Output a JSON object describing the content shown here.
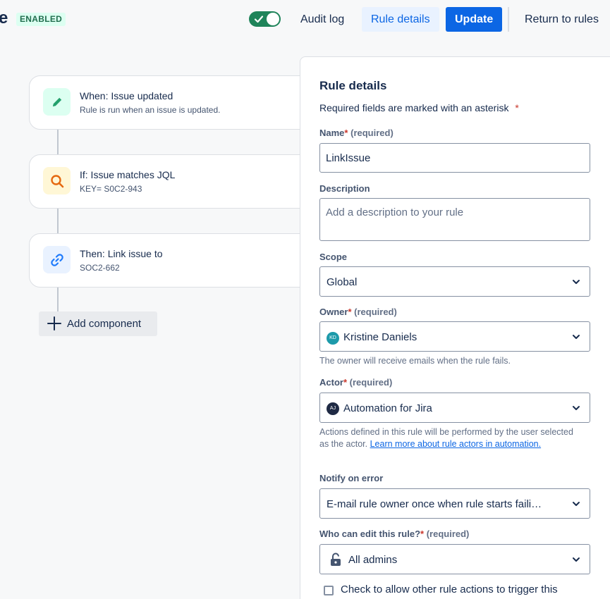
{
  "header": {
    "title_fragment": "e",
    "status_badge": "ENABLED",
    "audit_log_label": "Audit log",
    "rule_details_label": "Rule details",
    "update_label": "Update",
    "return_label": "Return to rules",
    "toggle_enabled": true
  },
  "flow": {
    "steps": [
      {
        "title": "When: Issue updated",
        "subtitle": "Rule is run when an issue is updated.",
        "icon": "pencil-icon",
        "icon_bg": "#dcfff1",
        "icon_color": "#22a06b"
      },
      {
        "title": "If: Issue matches JQL",
        "subtitle": "KEY= S0C2-943",
        "icon": "search-icon",
        "icon_bg": "#fff7d6",
        "icon_color": "#e56910"
      },
      {
        "title": "Then: Link issue to",
        "subtitle": "SOC2-662",
        "icon": "link-icon",
        "icon_bg": "#e9f2ff",
        "icon_color": "#1d7afc"
      }
    ],
    "add_component_label": "Add component"
  },
  "panel": {
    "title": "Rule details",
    "required_note": "Required fields are marked with an asterisk",
    "asterisk": "*",
    "required_suffix": "(required)",
    "name": {
      "label": "Name",
      "value": "LinkIssue"
    },
    "description": {
      "label": "Description",
      "placeholder": "Add a description to your rule"
    },
    "scope": {
      "label": "Scope",
      "value": "Global"
    },
    "owner": {
      "label": "Owner",
      "value": "Kristine Daniels",
      "avatar": "KD",
      "helper": "The owner will receive emails when the rule fails."
    },
    "actor": {
      "label": "Actor",
      "value": "Automation for Jira",
      "avatar": "AJ",
      "helper_text": "Actions defined in this rule will be performed by the user selected as the actor.",
      "helper_link": "Learn more about rule actors in automation."
    },
    "notify": {
      "label": "Notify on error",
      "value": "E-mail rule owner once when rule starts faili…"
    },
    "who_can_edit": {
      "label": "Who can edit this rule?",
      "value": "All admins"
    },
    "allow_trigger": {
      "label": "Check to allow other rule actions to trigger this",
      "checked": false
    }
  },
  "colors": {
    "primary": "#0c66e4",
    "success": "#1f845a",
    "danger": "#c9372c"
  }
}
